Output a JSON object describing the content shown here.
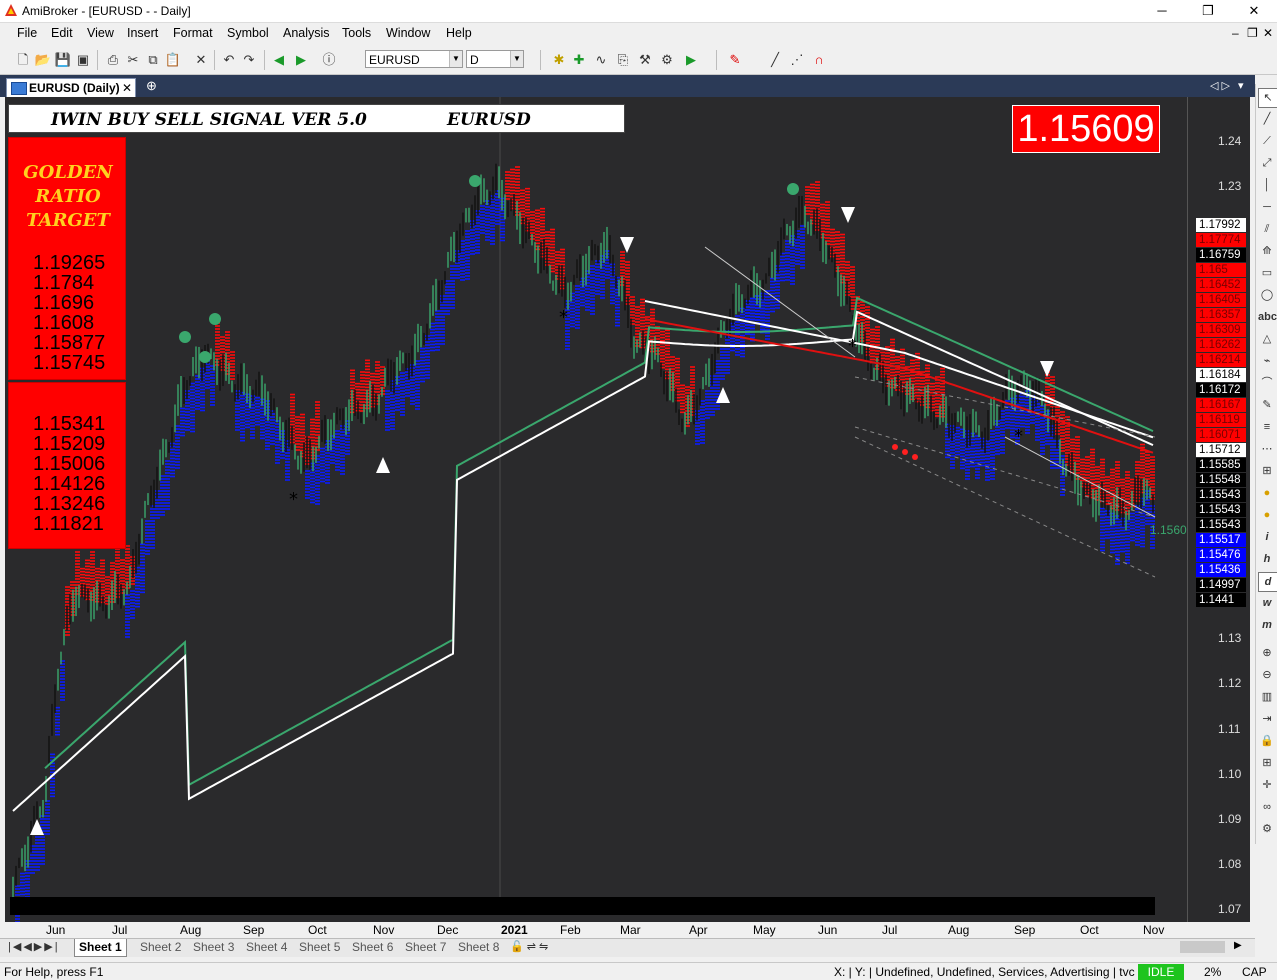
{
  "window": {
    "title": "AmiBroker - [EURUSD -  - Daily]",
    "minimize": "─",
    "restore": "❐",
    "close": "✕"
  },
  "menu": {
    "items": [
      "File",
      "Edit",
      "View",
      "Insert",
      "Format",
      "Symbol",
      "Analysis",
      "Tools",
      "Window",
      "Help"
    ],
    "mdi_minimize": "–",
    "mdi_restore": "❐",
    "mdi_close": "✕"
  },
  "toolbar": {
    "symbol": "EURUSD",
    "interval": "D"
  },
  "doc_tab": {
    "label": "EURUSD (Daily)",
    "close": "✕",
    "add": "⊕"
  },
  "overlay": {
    "indicator_title": "IWIN BUY SELL SIGNAL VER 5.0",
    "symbol": "EURUSD",
    "last_price": "1.15609",
    "golden_title": [
      "GOLDEN",
      "RATIO",
      "TARGET"
    ],
    "targets": [
      "1.19265",
      "1.1784",
      "1.1696",
      "1.1608",
      "1.15877",
      "1.15745"
    ],
    "supports": [
      "1.15341",
      "1.15209",
      "1.15006",
      "1.14126",
      "1.13246",
      "1.11821"
    ],
    "current_label": "1.1560"
  },
  "chart_data": {
    "type": "candlestick",
    "symbol": "EURUSD",
    "interval": "Daily",
    "y_ticks": [
      "1.24",
      "1.23",
      "1.13",
      "1.12",
      "1.11",
      "1.10",
      "1.09",
      "1.08",
      "1.07"
    ],
    "ylim": [
      1.065,
      1.245
    ],
    "x_ticks": [
      "Jun",
      "Jul",
      "Aug",
      "Sep",
      "Oct",
      "Nov",
      "Dec",
      "2021",
      "Feb",
      "Mar",
      "Apr",
      "May",
      "Jun",
      "Jul",
      "Aug",
      "Sep",
      "Oct",
      "Nov"
    ],
    "price_labels": [
      {
        "value": "1.17992",
        "bg": "#ffffff",
        "fg": "#000000"
      },
      {
        "value": "1.17774",
        "bg": "#ff0000",
        "fg": "#7a0000"
      },
      {
        "value": "1.16759",
        "bg": "#000000",
        "fg": "#ffffff"
      },
      {
        "value": "1.165",
        "bg": "#ff0000",
        "fg": "#7a0000"
      },
      {
        "value": "1.16452",
        "bg": "#ff0000",
        "fg": "#7a0000"
      },
      {
        "value": "1.16405",
        "bg": "#ff0000",
        "fg": "#7a0000"
      },
      {
        "value": "1.16357",
        "bg": "#ff0000",
        "fg": "#7a0000"
      },
      {
        "value": "1.16309",
        "bg": "#ff0000",
        "fg": "#7a0000"
      },
      {
        "value": "1.16262",
        "bg": "#ff0000",
        "fg": "#7a0000"
      },
      {
        "value": "1.16214",
        "bg": "#ff0000",
        "fg": "#7a0000"
      },
      {
        "value": "1.16184",
        "bg": "#ffffff",
        "fg": "#000000"
      },
      {
        "value": "1.16172",
        "bg": "#000000",
        "fg": "#ffffff"
      },
      {
        "value": "1.16167",
        "bg": "#ff0000",
        "fg": "#7a0000"
      },
      {
        "value": "1.16119",
        "bg": "#ff0000",
        "fg": "#7a0000"
      },
      {
        "value": "1.16071",
        "bg": "#ff0000",
        "fg": "#7a0000"
      },
      {
        "value": "1.15712",
        "bg": "#ffffff",
        "fg": "#000000"
      },
      {
        "value": "1.15585",
        "bg": "#000000",
        "fg": "#ffffff"
      },
      {
        "value": "1.15548",
        "bg": "#000000",
        "fg": "#ffffff"
      },
      {
        "value": "1.15543",
        "bg": "#000000",
        "fg": "#ffffff"
      },
      {
        "value": "1.15543",
        "bg": "#000000",
        "fg": "#ffffff"
      },
      {
        "value": "1.15543",
        "bg": "#000000",
        "fg": "#ffffff"
      },
      {
        "value": "1.15517",
        "bg": "#0000ff",
        "fg": "#ffffff"
      },
      {
        "value": "1.15476",
        "bg": "#0000ff",
        "fg": "#ffffff"
      },
      {
        "value": "1.15436",
        "bg": "#0000ff",
        "fg": "#ffffff"
      },
      {
        "value": "1.14997",
        "bg": "#000000",
        "fg": "#ffffff"
      },
      {
        "value": "1.1441",
        "bg": "#000000",
        "fg": "#ffffff"
      }
    ],
    "colors": {
      "background": "#2a2a2c",
      "bull": "#3aa76d",
      "bear": "#000000",
      "buy_band": "#0a1cff",
      "sell_band": "#ff0a0a",
      "ma_white": "#ffffff",
      "ma_green": "#3aa76d",
      "ma_red": "#e01010"
    }
  },
  "sheets": {
    "tabs": [
      "Sheet 1",
      "Sheet 2",
      "Sheet 3",
      "Sheet 4",
      "Sheet 5",
      "Sheet 6",
      "Sheet 7",
      "Sheet 8"
    ],
    "active": "Sheet 1"
  },
  "status": {
    "help": "For Help, press F1",
    "coords": "X: | Y: | Undefined, Undefined, Services, Advertising | tvc",
    "idle": "IDLE",
    "cpu": "2%",
    "caps": "CAP"
  }
}
